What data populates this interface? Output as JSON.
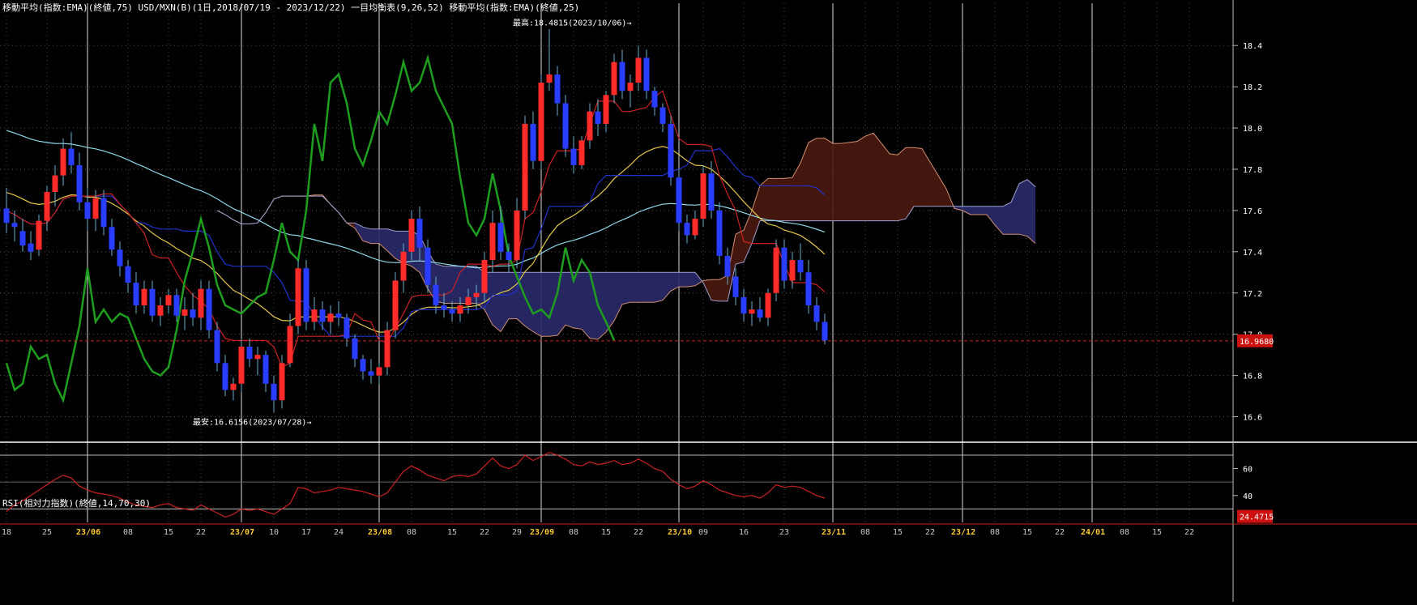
{
  "header": {
    "main_title": "移動平均(指数:EMA)(終値,75)  USD/MXN(B)(1日,2018/07/19 - 2023/12/22)  一目均衡表(9,26,52)  移動平均(指数:EMA)(終値,25)",
    "rsi_title": "RSI(相対力指数)(終値,14,70,30)"
  },
  "colors": {
    "bull": "#ff2a2a",
    "bear": "#2a3cff",
    "ema75": "#8fd8e8",
    "ema25": "#e6c84a",
    "tenkan": "#cc2222",
    "kijun": "#2233cc",
    "chikou": "#1e9e1e",
    "cloud_bear": "#2a2a6a",
    "cloud_bull": "#4a1a10",
    "rsi": "#cc2222",
    "price_line": "#cc2222"
  },
  "chart_data": [
    {
      "type": "candlestick",
      "title": "USD/MXN(B)(1日,2018/07/19 - 2023/12/22)",
      "ylim": [
        16.5,
        18.55
      ],
      "yticks": [
        16.6,
        16.8,
        17.0,
        17.2,
        17.4,
        17.6,
        17.8,
        18.0,
        18.2,
        18.4
      ],
      "ytick_labels": [
        "16.6",
        "16.8",
        "17.0",
        "17.2",
        "17.4",
        "17.6",
        "17.8",
        "18.0",
        "18.2",
        "18.4"
      ],
      "current_price": "16.9680",
      "current_value": 16.968,
      "annotations": [
        {
          "text": "最高:18.4815(2023/10/06)→",
          "index": 72,
          "value": 18.4815
        },
        {
          "text": "最安:16.6156(2023/07/28)→",
          "index": 37,
          "value": 16.6156
        }
      ],
      "ohlc": [
        [
          17.61,
          17.71,
          17.49,
          17.54
        ],
        [
          17.54,
          17.6,
          17.45,
          17.52
        ],
        [
          17.5,
          17.56,
          17.4,
          17.43
        ],
        [
          17.44,
          17.5,
          17.36,
          17.4
        ],
        [
          17.41,
          17.58,
          17.38,
          17.55
        ],
        [
          17.55,
          17.72,
          17.5,
          17.69
        ],
        [
          17.69,
          17.82,
          17.62,
          17.77
        ],
        [
          17.77,
          17.95,
          17.72,
          17.9
        ],
        [
          17.9,
          17.98,
          17.78,
          17.82
        ],
        [
          17.82,
          17.88,
          17.6,
          17.64
        ],
        [
          17.64,
          17.71,
          17.5,
          17.56
        ],
        [
          17.56,
          17.7,
          17.5,
          17.66
        ],
        [
          17.66,
          17.7,
          17.48,
          17.52
        ],
        [
          17.52,
          17.56,
          17.38,
          17.41
        ],
        [
          17.41,
          17.45,
          17.28,
          17.33
        ],
        [
          17.33,
          17.36,
          17.2,
          17.25
        ],
        [
          17.25,
          17.3,
          17.1,
          17.14
        ],
        [
          17.14,
          17.26,
          17.1,
          17.22
        ],
        [
          17.22,
          17.26,
          17.06,
          17.09
        ],
        [
          17.09,
          17.18,
          17.04,
          17.14
        ],
        [
          17.14,
          17.22,
          17.1,
          17.19
        ],
        [
          17.19,
          17.22,
          17.06,
          17.09
        ],
        [
          17.09,
          17.18,
          17.02,
          17.12
        ],
        [
          17.12,
          17.2,
          17.04,
          17.08
        ],
        [
          17.08,
          17.26,
          17.02,
          17.22
        ],
        [
          17.22,
          17.26,
          16.98,
          17.02
        ],
        [
          17.02,
          17.06,
          16.82,
          16.86
        ],
        [
          16.86,
          16.9,
          16.7,
          16.73
        ],
        [
          16.73,
          16.79,
          16.68,
          16.76
        ],
        [
          16.76,
          16.98,
          16.72,
          16.94
        ],
        [
          16.94,
          16.98,
          16.84,
          16.88
        ],
        [
          16.88,
          16.94,
          16.8,
          16.9
        ],
        [
          16.9,
          16.92,
          16.72,
          16.76
        ],
        [
          16.76,
          16.8,
          16.62,
          16.68
        ],
        [
          16.68,
          16.9,
          16.64,
          16.86
        ],
        [
          16.86,
          17.1,
          16.84,
          17.04
        ],
        [
          17.04,
          17.36,
          17.0,
          17.32
        ],
        [
          17.32,
          17.36,
          17.02,
          17.06
        ],
        [
          17.06,
          17.18,
          17.02,
          17.12
        ],
        [
          17.12,
          17.16,
          17.02,
          17.06
        ],
        [
          17.06,
          17.14,
          17.0,
          17.1
        ],
        [
          17.1,
          17.16,
          17.04,
          17.08
        ],
        [
          17.08,
          17.1,
          16.94,
          16.98
        ],
        [
          16.98,
          17.0,
          16.84,
          16.88
        ],
        [
          16.88,
          16.9,
          16.78,
          16.82
        ],
        [
          16.82,
          16.88,
          16.76,
          16.8
        ],
        [
          16.8,
          16.86,
          16.76,
          16.84
        ],
        [
          16.84,
          17.06,
          16.8,
          17.02
        ],
        [
          17.02,
          17.3,
          16.98,
          17.26
        ],
        [
          17.26,
          17.44,
          17.2,
          17.4
        ],
        [
          17.4,
          17.6,
          17.36,
          17.56
        ],
        [
          17.56,
          17.62,
          17.36,
          17.42
        ],
        [
          17.42,
          17.46,
          17.2,
          17.24
        ],
        [
          17.24,
          17.28,
          17.1,
          17.14
        ],
        [
          17.14,
          17.2,
          17.08,
          17.12
        ],
        [
          17.12,
          17.16,
          17.06,
          17.1
        ],
        [
          17.1,
          17.18,
          17.06,
          17.14
        ],
        [
          17.14,
          17.22,
          17.1,
          17.18
        ],
        [
          17.18,
          17.24,
          17.12,
          17.2
        ],
        [
          17.2,
          17.4,
          17.16,
          17.36
        ],
        [
          17.36,
          17.6,
          17.3,
          17.54
        ],
        [
          17.54,
          17.62,
          17.36,
          17.4
        ],
        [
          17.4,
          17.44,
          17.3,
          17.36
        ],
        [
          17.36,
          17.66,
          17.32,
          17.6
        ],
        [
          17.6,
          18.06,
          17.56,
          18.02
        ],
        [
          18.02,
          18.08,
          17.8,
          17.84
        ],
        [
          17.84,
          18.26,
          17.8,
          18.22
        ],
        [
          18.22,
          18.48,
          18.18,
          18.26
        ],
        [
          18.26,
          18.3,
          18.06,
          18.12
        ],
        [
          18.12,
          18.16,
          17.86,
          17.9
        ],
        [
          17.9,
          17.96,
          17.78,
          17.82
        ],
        [
          17.82,
          17.96,
          17.8,
          17.94
        ],
        [
          17.94,
          18.12,
          17.9,
          18.08
        ],
        [
          18.08,
          18.14,
          17.96,
          18.02
        ],
        [
          18.02,
          18.18,
          17.98,
          18.16
        ],
        [
          18.16,
          18.36,
          18.12,
          18.32
        ],
        [
          18.32,
          18.38,
          18.14,
          18.18
        ],
        [
          18.18,
          18.26,
          18.1,
          18.22
        ],
        [
          18.22,
          18.4,
          18.18,
          18.34
        ],
        [
          18.34,
          18.38,
          18.14,
          18.18
        ],
        [
          18.18,
          18.2,
          18.06,
          18.1
        ],
        [
          18.1,
          18.12,
          17.98,
          18.02
        ],
        [
          18.02,
          18.06,
          17.72,
          17.76
        ],
        [
          17.76,
          17.8,
          17.5,
          17.54
        ],
        [
          17.54,
          17.58,
          17.44,
          17.48
        ],
        [
          17.48,
          17.6,
          17.46,
          17.56
        ],
        [
          17.56,
          17.82,
          17.52,
          17.78
        ],
        [
          17.78,
          17.84,
          17.56,
          17.6
        ],
        [
          17.6,
          17.64,
          17.34,
          17.38
        ],
        [
          17.38,
          17.42,
          17.24,
          17.28
        ],
        [
          17.28,
          17.32,
          17.14,
          17.18
        ],
        [
          17.18,
          17.22,
          17.06,
          17.1
        ],
        [
          17.1,
          17.16,
          17.04,
          17.12
        ],
        [
          17.12,
          17.18,
          17.06,
          17.08
        ],
        [
          17.08,
          17.22,
          17.04,
          17.2
        ],
        [
          17.2,
          17.46,
          17.16,
          17.42
        ],
        [
          17.42,
          17.46,
          17.22,
          17.26
        ],
        [
          17.26,
          17.4,
          17.22,
          17.36
        ],
        [
          17.36,
          17.44,
          17.26,
          17.3
        ],
        [
          17.3,
          17.36,
          17.1,
          17.14
        ],
        [
          17.14,
          17.18,
          17.02,
          17.06
        ],
        [
          17.06,
          17.1,
          16.95,
          16.97
        ]
      ],
      "x_ticks": [
        {
          "index": 0,
          "label": "18",
          "month": false
        },
        {
          "index": 5,
          "label": "25",
          "month": false
        },
        {
          "index": 10,
          "label": "23/06",
          "month": true
        },
        {
          "index": 15,
          "label": "08",
          "month": false
        },
        {
          "index": 20,
          "label": "15",
          "month": false
        },
        {
          "index": 24,
          "label": "22",
          "month": false
        },
        {
          "index": 29,
          "label": "23/07",
          "month": true
        },
        {
          "index": 33,
          "label": "10",
          "month": false
        },
        {
          "index": 37,
          "label": "17",
          "month": false
        },
        {
          "index": 41,
          "label": "24",
          "month": false
        },
        {
          "index": 46,
          "label": "23/08",
          "month": true
        },
        {
          "index": 50,
          "label": "08",
          "month": false
        },
        {
          "index": 55,
          "label": "15",
          "month": false
        },
        {
          "index": 59,
          "label": "22",
          "month": false
        },
        {
          "index": 63,
          "label": "29",
          "month": false
        },
        {
          "index": 66,
          "label": "23/09",
          "month": true
        },
        {
          "index": 70,
          "label": "08",
          "month": false
        },
        {
          "index": 74,
          "label": "15",
          "month": false
        },
        {
          "index": 78,
          "label": "22",
          "month": false
        },
        {
          "index": 83,
          "label": "23/10",
          "month": true
        },
        {
          "index": 86,
          "label": "09",
          "month": false
        },
        {
          "index": 91,
          "label": "16",
          "month": false
        },
        {
          "index": 96,
          "label": "23",
          "month": false
        },
        {
          "index": 102,
          "label": "23/11",
          "month": true
        },
        {
          "index": 106,
          "label": "08",
          "month": false
        },
        {
          "index": 110,
          "label": "15",
          "month": false
        },
        {
          "index": 114,
          "label": "22",
          "month": false
        },
        {
          "index": 118,
          "label": "23/12",
          "month": true
        },
        {
          "index": 122,
          "label": "08",
          "month": false
        },
        {
          "index": 126,
          "label": "15",
          "month": false
        },
        {
          "index": 130,
          "label": "22",
          "month": false
        },
        {
          "index": 134,
          "label": "24/01",
          "month": true
        },
        {
          "index": 138,
          "label": "08",
          "month": false
        },
        {
          "index": 142,
          "label": "15",
          "month": false
        },
        {
          "index": 146,
          "label": "22",
          "month": false
        }
      ]
    },
    {
      "type": "line",
      "title": "RSI(相対力指数)(終値,14,70,30)",
      "ylim": [
        20,
        76
      ],
      "yticks": [
        40,
        60
      ],
      "ytick_labels": [
        "40",
        "60"
      ],
      "levels": [
        30,
        70
      ],
      "current_value": "24.4715",
      "current_numeric": 24.4715,
      "values": [
        28,
        33,
        36,
        40,
        44,
        48,
        52,
        55,
        53,
        47,
        44,
        42,
        41,
        40,
        38,
        35,
        33,
        32,
        31,
        33,
        34,
        31,
        30,
        29,
        33,
        30,
        27,
        24,
        26,
        30,
        29,
        30,
        28,
        26,
        30,
        34,
        46,
        45,
        42,
        43,
        44,
        46,
        45,
        44,
        43,
        41,
        39,
        42,
        50,
        58,
        62,
        59,
        55,
        53,
        51,
        54,
        55,
        54,
        56,
        62,
        68,
        62,
        60,
        63,
        70,
        66,
        69,
        72,
        70,
        67,
        63,
        62,
        65,
        63,
        64,
        66,
        63,
        64,
        67,
        64,
        60,
        58,
        52,
        48,
        45,
        47,
        51,
        48,
        44,
        42,
        40,
        39,
        40,
        38,
        42,
        48,
        46,
        47,
        46,
        43,
        40,
        38
      ]
    }
  ]
}
